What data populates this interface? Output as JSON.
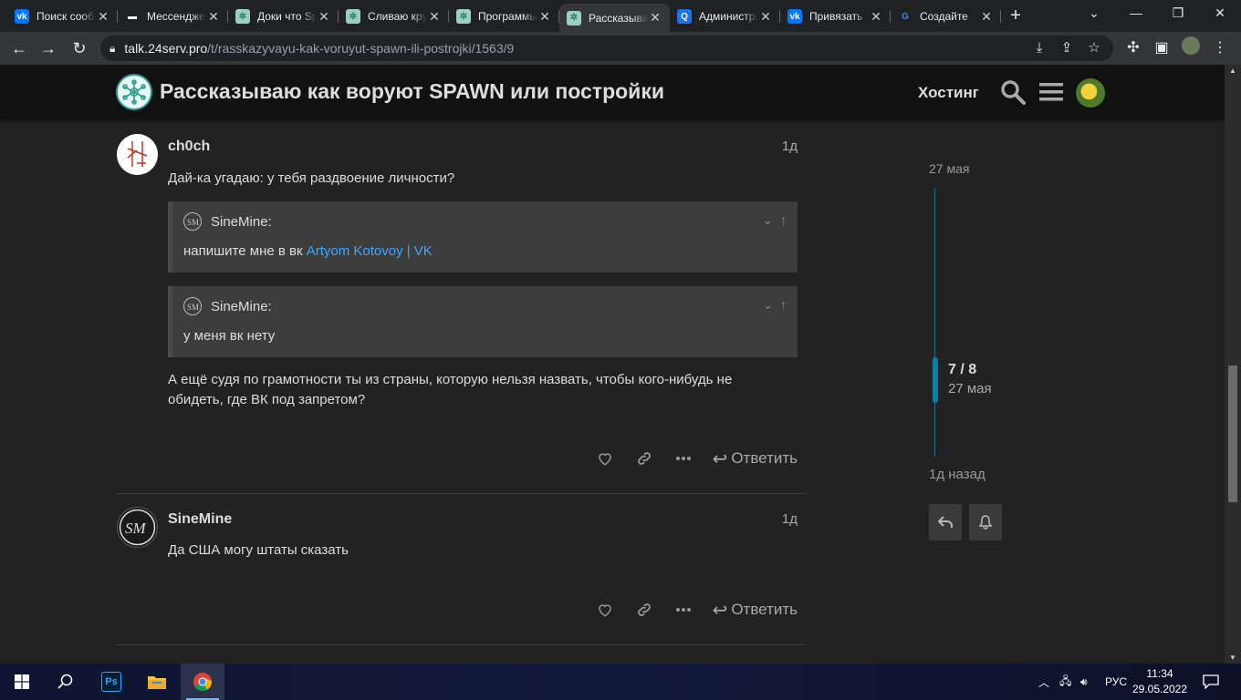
{
  "browser": {
    "tabs": [
      {
        "title": "Поиск сообщений",
        "icon": "vk-icon",
        "color": "#0077ff",
        "glyph": "vk"
      },
      {
        "title": "Мессенджер",
        "icon": "chat-icon",
        "color": "#ffffff",
        "glyph": "▬"
      },
      {
        "title": "Доки что Sp",
        "icon": "discourse-icon",
        "color": "#9ad0c2",
        "glyph": "✲"
      },
      {
        "title": "Сливаю крутое",
        "icon": "discourse-icon",
        "color": "#9ad0c2",
        "glyph": "✲"
      },
      {
        "title": "Программы",
        "icon": "discourse-icon",
        "color": "#9ad0c2",
        "glyph": "✲"
      },
      {
        "title": "Рассказываю",
        "icon": "discourse-icon",
        "color": "#9ad0c2",
        "glyph": "✲",
        "active": true
      },
      {
        "title": "Администратор",
        "icon": "search-q-icon",
        "color": "#1a73e8",
        "glyph": "Q"
      },
      {
        "title": "Привязать",
        "icon": "vk-icon",
        "color": "#0077ff",
        "glyph": "vk"
      },
      {
        "title": "Создайте",
        "icon": "google-icon",
        "color": "#ffffff",
        "glyph": "G"
      }
    ],
    "url_host": "talk.24serv.pro",
    "url_path": "/t/rasskazyvayu-kak-voruyut-spawn-ili-postrojki/1563/9"
  },
  "site": {
    "title": "Рассказываю как воруют SPAWN или постройки",
    "hosting_label": "Хостинг"
  },
  "posts": [
    {
      "username": "ch0ch",
      "date": "1д",
      "intro": "Дай-ка угадаю: у тебя раздвоение личности?",
      "quotes": [
        {
          "author": "SineMine:",
          "text": "напишите мне в вк ",
          "link": "Artyom Kotovoy | VK"
        },
        {
          "author": "SineMine:",
          "text": "у меня вк нету",
          "link": ""
        }
      ],
      "body_line1": "А ещё судя по грамотности ты из страны, которую нельзя назвать, чтобы кого-нибудь не",
      "body_line2": "обидеть, где ВК под запретом?",
      "reply_label": "Ответить"
    },
    {
      "username": "SineMine",
      "date": "1д",
      "body": "Да США могу штаты сказать",
      "reply_label": "Ответить"
    }
  ],
  "timeline": {
    "top_date": "27 мая",
    "position": "7 / 8",
    "position_date": "27 мая",
    "bottom_label": "1д назад"
  },
  "taskbar": {
    "lang": "РУС",
    "time": "11:34",
    "date": "29.05.2022"
  }
}
